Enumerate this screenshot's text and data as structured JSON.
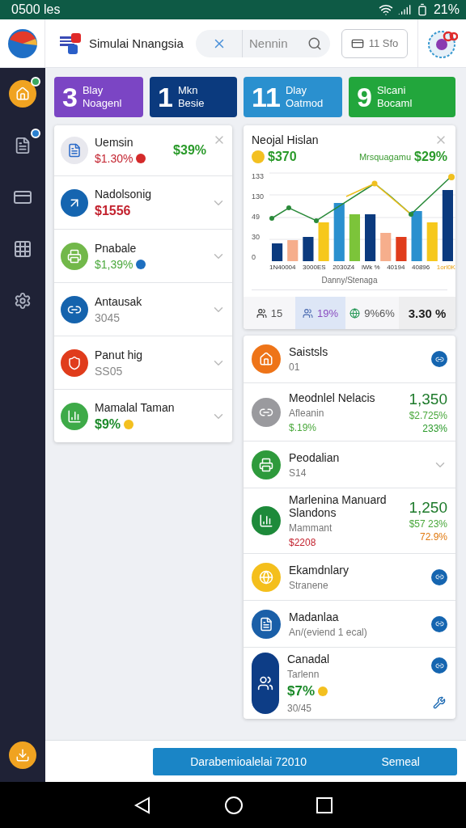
{
  "status_bar": {
    "time": "0500 les",
    "battery": "21%"
  },
  "header": {
    "app_title": "Simulai Nnangsia",
    "search": {
      "placeholder": "Nennin"
    },
    "counter": "11 Sfo"
  },
  "stat_tiles": [
    {
      "number": "3",
      "line_1": "Blay",
      "line_2": "Noagenl",
      "color": "#7b45c4"
    },
    {
      "number": "1",
      "line_1": "Mkn",
      "line_2": "Besie",
      "color": "#0b3a7e"
    },
    {
      "number": "11",
      "line_1": "Dlay",
      "line_2": "Oatmod",
      "color": "#2a90cf"
    },
    {
      "number": "9",
      "line_1": "Slcani",
      "line_2": "Bocaml",
      "color": "#22a63c"
    }
  ],
  "left_list": [
    {
      "name": "Uemsin",
      "value": {
        "text": "$1.30%",
        "color": "#c3232f",
        "bold": false
      },
      "dot": {
        "color": "#d42a2a"
      },
      "right": "$39%",
      "closable": true,
      "color": "#e8e8ee"
    },
    {
      "name": "Nadolsonig",
      "value": {
        "text": "$1556",
        "color": "#c3232f",
        "bold": true
      },
      "expandable": true,
      "color": "#1565b0"
    },
    {
      "name": "Pnabale",
      "value": {
        "text": "$1,39%",
        "color": "#4aa83c",
        "bold": false
      },
      "dot": {
        "color": "#1e6fc0"
      },
      "expandable": true,
      "color": "#72b84a"
    },
    {
      "name": "Antausak",
      "value": {
        "text": "3045",
        "color": "#888888",
        "bold": false
      },
      "expandable": true,
      "color": "#1563ad"
    },
    {
      "name": "Panut hig",
      "value": {
        "text": "SS05",
        "color": "#888888",
        "bold": false
      },
      "expandable": true,
      "color": "#e03c1c"
    },
    {
      "name": "Mamalal Taman",
      "value": {
        "text": "$9%",
        "color": "#1c8a2a",
        "bold": true
      },
      "dot": {
        "color": "#f3c020"
      },
      "expandable": true,
      "color": "#3eaa48"
    }
  ],
  "chart_card": {
    "title": "Neojal Hislan",
    "amount": "$370",
    "caption": "Mrsquagamu",
    "change": "$29%",
    "y_ticks": [
      "133",
      "130",
      "49",
      "30",
      "0"
    ],
    "x_labels": [
      "1N40004",
      "3000ES",
      "2030Z4",
      "lWk %",
      "40194",
      "40896",
      "1orl0K"
    ],
    "axis_title": "Danny/Stenaga",
    "stats": [
      {
        "text": "15",
        "selected": false
      },
      {
        "text": "19%",
        "selected": true
      },
      {
        "text": "9%6%",
        "selected": false
      },
      {
        "text": "3.30 %",
        "selected": false
      }
    ]
  },
  "right_list": [
    {
      "name": "Saistsls",
      "lines": [
        "01"
      ],
      "linked": true,
      "color": "#ee7418"
    },
    {
      "name": "Meodnlel Nelacis",
      "lines": [
        "Afleanin",
        "$.19%"
      ],
      "figures": [
        "1,350",
        "$2.725%",
        "233%"
      ],
      "color": "#9a9a9e"
    },
    {
      "name": "Peodalian",
      "lines": [
        "S14"
      ],
      "expandable": true,
      "color": "#2e9a3c"
    },
    {
      "name": "Marlenina Manuard Slandons",
      "lines": [
        "Mammant",
        "$2208"
      ],
      "figures": [
        "1,250",
        "$57 23%",
        "72.9%"
      ],
      "color": "#1d8a3a"
    },
    {
      "name": "Ekamdnlary",
      "lines": [
        "Stranene"
      ],
      "linked": true,
      "color": "#f4bf1c"
    },
    {
      "name": "Madanlaa",
      "lines": [
        "An/(eviend 1 ecal)"
      ],
      "linked": true,
      "color": "#1a5fa8"
    },
    {
      "name": "Canadal",
      "lines": [
        "Tarlenn",
        "$7%",
        "30/45"
      ],
      "linked": true,
      "color": "#0d3d86"
    }
  ],
  "footer": {
    "primary": "Darabemioalelai 72010",
    "secondary": "Semeal"
  }
}
